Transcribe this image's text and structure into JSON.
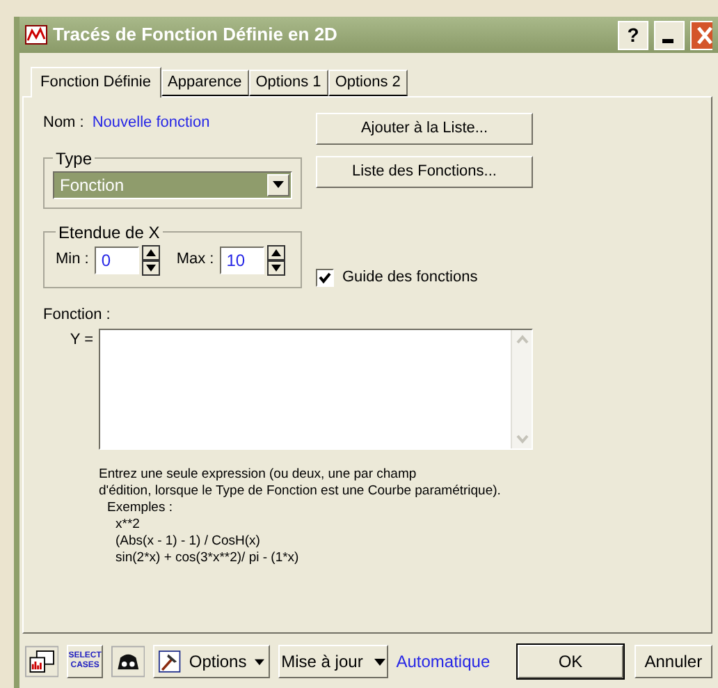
{
  "window": {
    "title": "Tracés de Fonction Définie en 2D",
    "help_button": "?"
  },
  "tabs": [
    {
      "label": "Fonction Définie",
      "selected": true
    },
    {
      "label": "Apparence",
      "selected": false
    },
    {
      "label": "Options 1",
      "selected": false
    },
    {
      "label": "Options 2",
      "selected": false
    }
  ],
  "name": {
    "label": "Nom :",
    "value": "Nouvelle fonction"
  },
  "type_group": {
    "legend": "Type",
    "value": "Fonction"
  },
  "range_group": {
    "legend": "Etendue de X",
    "min_label": "Min :",
    "min_value": "0",
    "max_label": "Max :",
    "max_value": "10"
  },
  "side_buttons": [
    "Ajouter à la Liste...",
    "Liste des Fonctions..."
  ],
  "guide": {
    "label": "Guide des fonctions",
    "checked": true
  },
  "function_label": "Fonction :",
  "y_label": "Y =",
  "help_lines": [
    "Entrez une seule expression (ou deux, une par champ",
    "d'édition, lorsque le Type de Fonction est une Courbe paramétrique)."
  ],
  "examples_label": "Exemples :",
  "examples": [
    "x**2",
    "(Abs(x - 1) - 1) / CosH(x)",
    "sin(2*x) + cos(3*x**2)/ pi - (1*x)"
  ],
  "toolbar": {
    "select_icon_lines": [
      "SELECT",
      "CASES"
    ],
    "options_button": "Options",
    "update_button": "Mise à jour",
    "update_mode": "Automatique",
    "ok_button": "OK",
    "cancel_button": "Annuler"
  }
}
